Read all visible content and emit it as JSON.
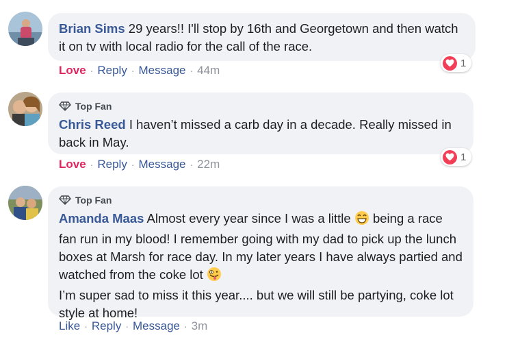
{
  "comments": [
    {
      "author": "Brian Sims",
      "text": "29 years!! I'll stop by 16th and Georgetown and then watch it on tv with local radio for the call of the race.",
      "actions": {
        "like": "Love",
        "reply": "Reply",
        "message": "Message",
        "time": "44m"
      },
      "reaction": {
        "icon": "love-reaction-icon",
        "count": "1"
      }
    },
    {
      "badge": "Top Fan",
      "author": "Chris Reed",
      "text": "I haven’t missed a carb day in a decade. Really missed in back in May.",
      "actions": {
        "like": "Love",
        "reply": "Reply",
        "message": "Message",
        "time": "22m"
      },
      "reaction": {
        "icon": "love-reaction-icon",
        "count": "1"
      }
    },
    {
      "badge": "Top Fan",
      "author": "Amanda Maas",
      "text_1": "Almost every year since I was a little",
      "emoji_1": "grinning-face-emoji",
      "text_2": "being a race fan run in my blood! I remember going with my dad to pick up the lunch boxes at Marsh for race day. In my later years I have always partied and watched from the coke lot",
      "emoji_2": "zany-face-emoji",
      "text_3": "I’m super sad to miss it this year.... but we will still be partying, coke lot style at home!",
      "actions": {
        "like": "Like",
        "reply": "Reply",
        "message": "Message",
        "time": "3m"
      }
    }
  ],
  "colors": {
    "author": "#385898",
    "love": "#e0245e",
    "bubble": "#f0f2f5",
    "heart": "#f33e58"
  }
}
